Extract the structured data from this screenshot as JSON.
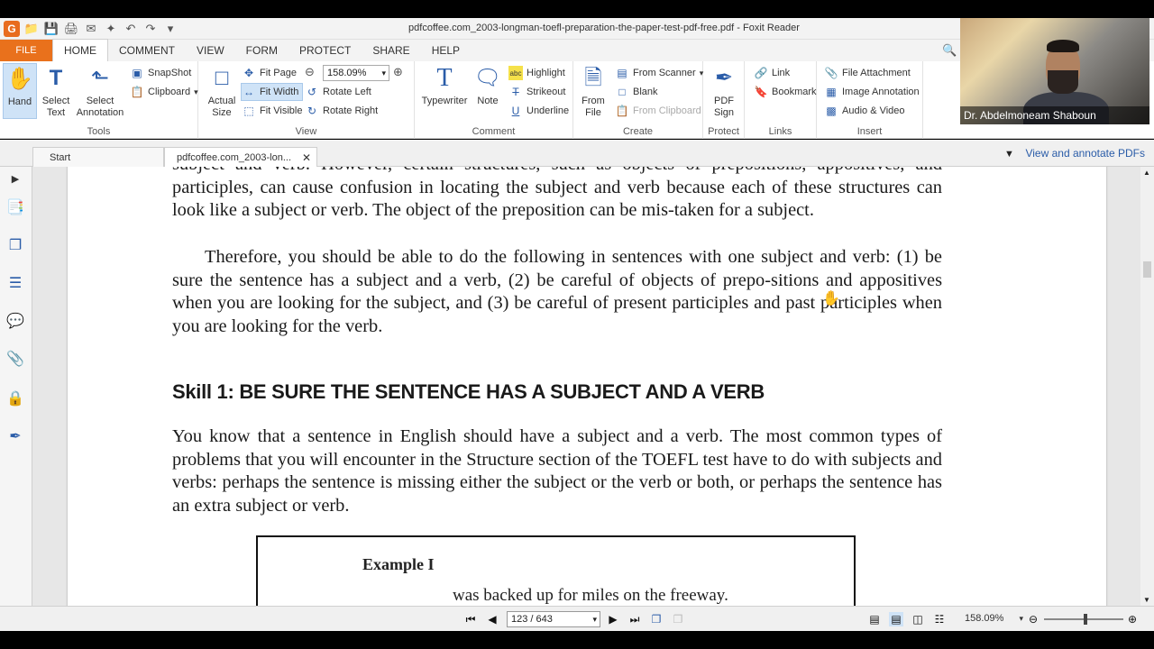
{
  "window": {
    "title": "pdfcoffee.com_2003-longman-toefl-preparation-the-paper-test-pdf-free.pdf - Foxit Reader"
  },
  "menu": {
    "file": "FILE",
    "tabs": [
      "HOME",
      "COMMENT",
      "VIEW",
      "FORM",
      "PROTECT",
      "SHARE",
      "HELP"
    ]
  },
  "ribbon": {
    "tools": {
      "label": "Tools",
      "hand": "Hand",
      "select_text": "Select\nText",
      "select_annotation": "Select\nAnnotation"
    },
    "snapshot": "SnapShot",
    "clipboard": "Clipboard",
    "view": {
      "label": "View",
      "actual_size": "Actual\nSize",
      "fit_page": "Fit Page",
      "fit_width": "Fit Width",
      "fit_visible": "Fit Visible",
      "zoom": "158.09%",
      "rotate_left": "Rotate Left",
      "rotate_right": "Rotate Right"
    },
    "comment": {
      "label": "Comment",
      "typewriter": "Typewriter",
      "note": "Note",
      "highlight": "Highlight",
      "strikeout": "Strikeout",
      "underline": "Underline"
    },
    "create": {
      "label": "Create",
      "from_file": "From\nFile",
      "from_scanner": "From Scanner",
      "blank": "Blank",
      "from_clipboard": "From Clipboard"
    },
    "protect": {
      "label": "Protect",
      "pdf_sign": "PDF\nSign"
    },
    "links": {
      "label": "Links",
      "link": "Link",
      "bookmark": "Bookmark"
    },
    "insert": {
      "label": "Insert",
      "file_attachment": "File Attachment",
      "image_annotation": "Image Annotation",
      "audio_video": "Audio & Video"
    }
  },
  "video": {
    "name": "Dr. Abdelmoneam Shaboun"
  },
  "tabs": {
    "start": "Start",
    "doc": "pdfcoffee.com_2003-lon...",
    "annotate": "View and annotate PDFs"
  },
  "document": {
    "para1": "subject and verb. However, certain structures, such as objects of prepositions, appositives, and participles, can cause confusion in locating the subject and verb because each of these structures can look like a subject or verb. The object of the preposition can be mis-taken for a subject.",
    "para2": "Therefore, you should be able to do the following in sentences with one subject and verb: (1) be sure the sentence has a subject and a verb, (2) be careful of objects of prepo-sitions and appositives when you are looking for the subject, and (3) be careful of present participles and past participles when you are looking for the verb.",
    "skill_heading": "Skill 1:   BE SURE THE SENTENCE HAS A SUBJECT AND A VERB",
    "para3": "You know that a sentence in English should have a subject and a verb. The most common types of problems that you will encounter in the Structure section of the TOEFL test have to do with subjects and verbs: perhaps the sentence is missing either the subject or the verb or both, or perhaps the sentence has an extra subject or verb.",
    "example_title": "Example I",
    "example_line": "was backed up for miles on the freeway."
  },
  "status": {
    "page": "123 / 643",
    "zoom": "158.09%"
  }
}
